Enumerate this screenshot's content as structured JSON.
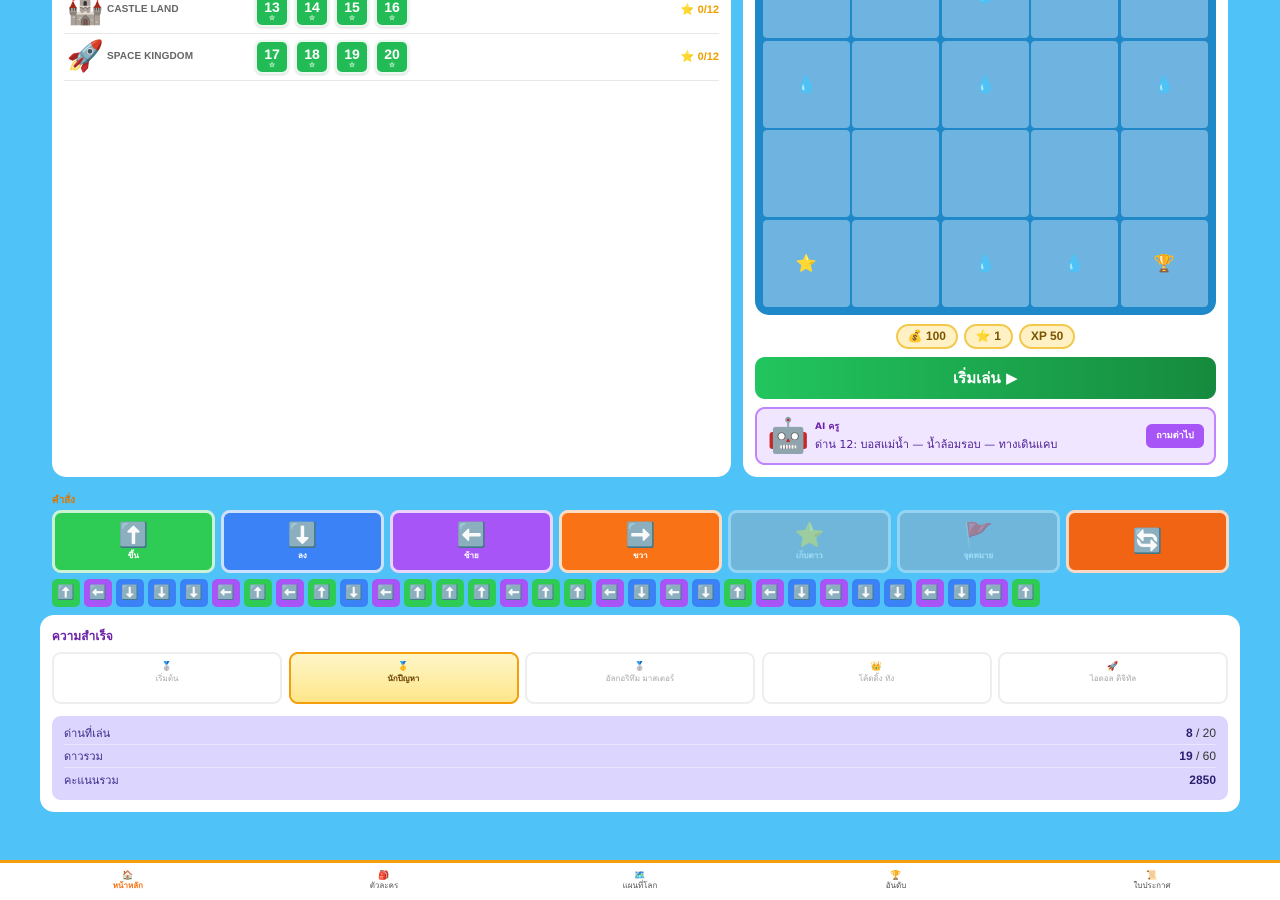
{
  "worlds": [
    {
      "icon": "🏰",
      "icon_name": "castle-icon",
      "name": "CASTLE LAND",
      "levels": [
        "13",
        "14",
        "15",
        "16"
      ],
      "level_star": "☆",
      "stars": "⭐ 0/12"
    },
    {
      "icon": "🚀",
      "icon_name": "rocket-icon",
      "name": "SPACE KINGDOM",
      "levels": [
        "17",
        "18",
        "19",
        "20"
      ],
      "level_star": "☆",
      "stars": "⭐ 0/12"
    }
  ],
  "board": {
    "drop": "💧",
    "star": "⭐",
    "trophy": "🏆"
  },
  "stats_pills": {
    "coins": "💰 100",
    "stars": "⭐ 1",
    "xp": "XP 50"
  },
  "start_label": "เริ่มเล่น ▶",
  "ai": {
    "avatar": "🤖",
    "name": "AI ครู",
    "message": "ด่าน 12: บอสแม่น้ำ — น้ำล้อมรอบ — ทางเดินแคบ",
    "ask_label": "ถามต่าไป"
  },
  "commands": {
    "title": "คำสั่ง",
    "items": [
      {
        "icon": "⬆️",
        "label": "ขึ้น",
        "color": "#2ecc55"
      },
      {
        "icon": "⬇️",
        "label": "ลง",
        "color": "#3b82f6"
      },
      {
        "icon": "⬅️",
        "label": "ซ้าย",
        "color": "#a855f7"
      },
      {
        "icon": "➡️",
        "label": "ขวา",
        "color": "#f97316"
      },
      {
        "icon": "⭐",
        "label": "เก็บดาว",
        "color": "#9aa8b8"
      },
      {
        "icon": "🚩",
        "label": "จุดหมาย",
        "color": "#9aa8b8"
      },
      {
        "icon": "🔄",
        "label": "",
        "color": "#f06414"
      }
    ]
  },
  "sequence_icons": {
    "up": "⬆️",
    "down": "⬇️",
    "left": "⬅️"
  },
  "sequence": [
    "up",
    "left",
    "down",
    "down",
    "down",
    "left",
    "up",
    "left",
    "up",
    "down",
    "left",
    "up",
    "up",
    "up",
    "left",
    "up",
    "up",
    "left",
    "down",
    "left",
    "down",
    "up",
    "left",
    "down",
    "left",
    "down",
    "down",
    "left",
    "down",
    "left",
    "up"
  ],
  "achievements": {
    "title": "ความสำเร็จ",
    "badges": [
      {
        "icon": "🥈",
        "label": "เริ่มต้น",
        "earned": false
      },
      {
        "icon": "🥇",
        "label": "นักปีญหา",
        "earned": true
      },
      {
        "icon": "🥈",
        "label": "อัลกอริทึม มาสเตอร์",
        "earned": false
      },
      {
        "icon": "👑",
        "label": "โค้ดดิ้ง ทัง",
        "earned": false
      },
      {
        "icon": "🚀",
        "label": "ไอดอล ดิจิทัล",
        "earned": false
      }
    ]
  },
  "stats": [
    {
      "label": "ด่านที่เล่น",
      "value": "8",
      "total": " / 20"
    },
    {
      "label": "ดาวรวม",
      "value": "19",
      "total": " / 60"
    },
    {
      "label": "คะแนนรวม",
      "value": "2850",
      "total": ""
    }
  ],
  "nav": [
    {
      "icon": "🏠",
      "label": "หน้าหลัก",
      "active": true
    },
    {
      "icon": "🎒",
      "label": "ตัวละคร",
      "active": false
    },
    {
      "icon": "🗺️",
      "label": "แผนที่โลก",
      "active": false
    },
    {
      "icon": "🏆",
      "label": "อันดับ",
      "active": false
    },
    {
      "icon": "📜",
      "label": "ใบประกาศ",
      "active": false
    }
  ]
}
